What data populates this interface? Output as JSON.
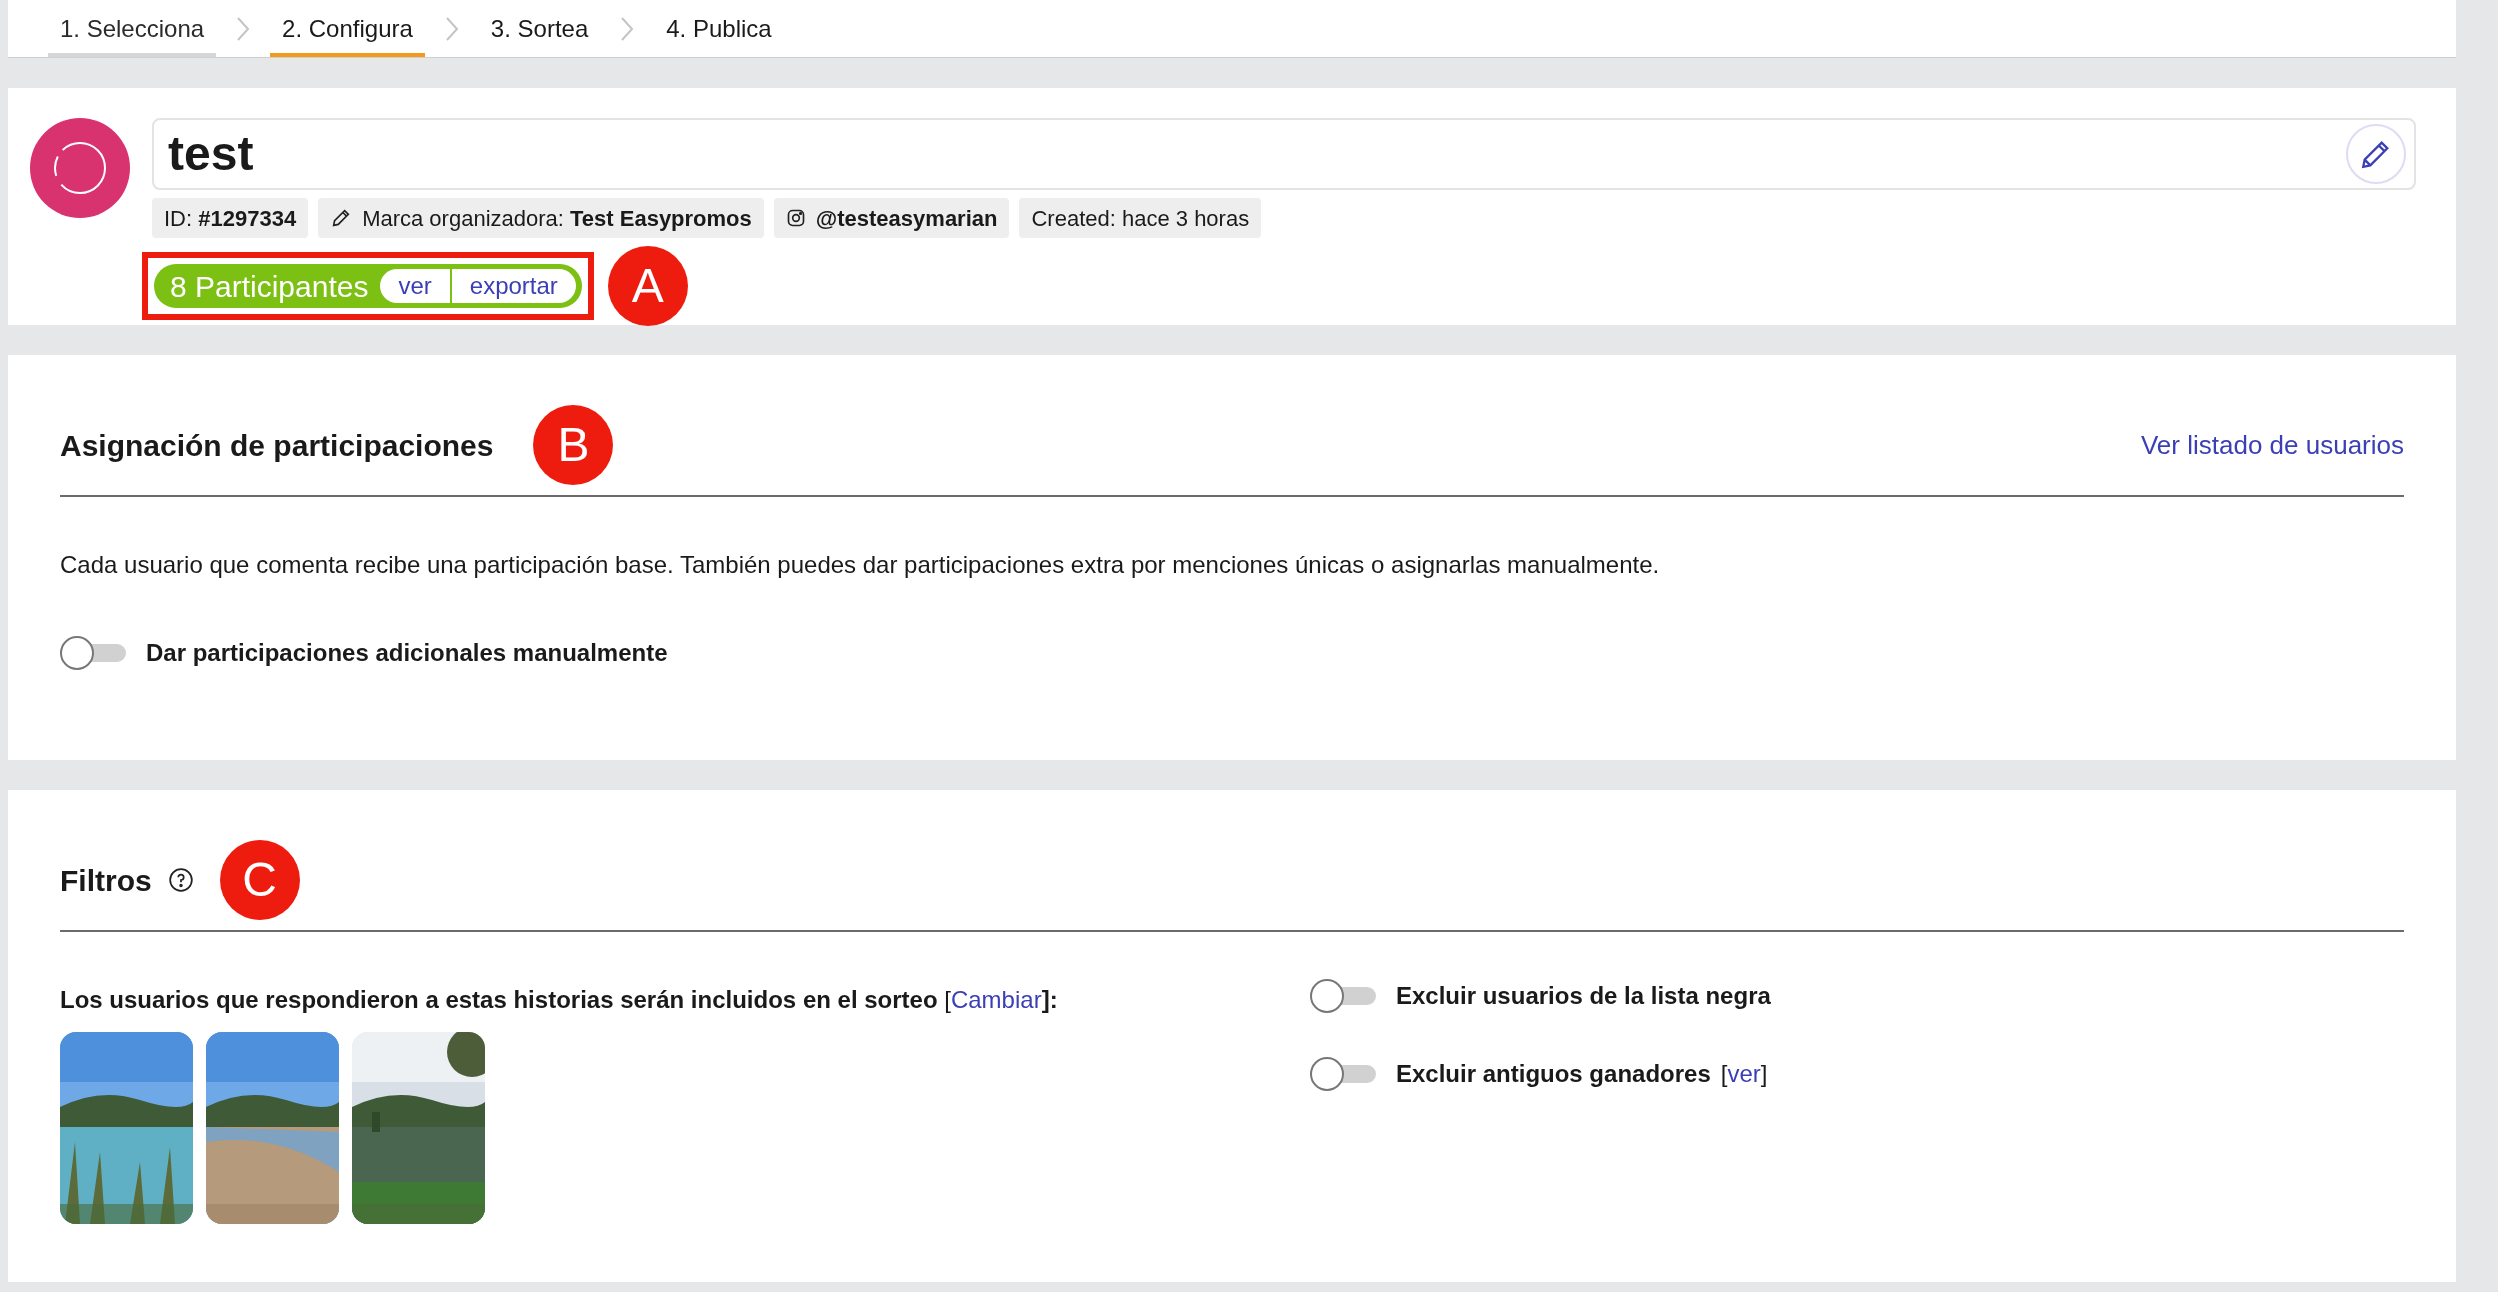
{
  "steps": [
    {
      "label": "1. Selecciona",
      "selected": false,
      "completed": true
    },
    {
      "label": "2. Configura",
      "selected": true,
      "completed": false
    },
    {
      "label": "3. Sortea",
      "selected": false,
      "completed": false
    },
    {
      "label": "4. Publica",
      "selected": false,
      "completed": false
    }
  ],
  "header": {
    "title": "test",
    "chips": [
      {
        "kind": "id",
        "text": "ID: **#1297334**"
      },
      {
        "kind": "brand",
        "text": "Marca organizadora: **Test Easypromos**"
      },
      {
        "kind": "account",
        "text": "**@testeasymarian**"
      },
      {
        "kind": "created",
        "text": "Created: hace 3 horas"
      }
    ],
    "participants": {
      "label": "8 Participantes",
      "actions": [
        "ver",
        "exportar"
      ],
      "highlighted": true,
      "marker": "A"
    }
  },
  "allocation": {
    "title": "Asignación de participaciones",
    "marker": "B",
    "link": "Ver listado de usuarios",
    "description": "Cada usuario que comenta recibe una participación base. También puedes dar participaciones extra por menciones únicas o asignarlas manualmente.",
    "toggles": [
      {
        "label": "Dar participaciones adicionales manualmente",
        "on": false
      }
    ]
  },
  "filters": {
    "title": "Filtros",
    "marker": "C",
    "stories_label": "Los usuarios que respondieron a estas historias serán incluidos en el sorteo",
    "link_open": "[",
    "link": "Cambiar",
    "link_close": "]:",
    "toggles": [
      {
        "label": "Excluir usuarios de la lista negra",
        "on": false
      },
      {
        "label": "Excluir antiguos ganadores",
        "on": false,
        "link_open": "[",
        "link": "ver",
        "link_close": "]"
      }
    ]
  }
}
